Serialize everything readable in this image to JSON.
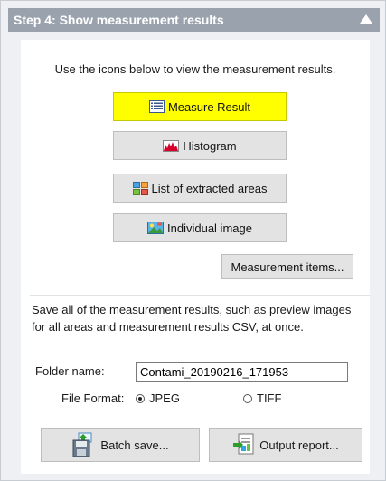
{
  "header": {
    "title": "Step 4: Show measurement results",
    "collapse_icon": "chevron-up-icon"
  },
  "intro": "Use the icons below to view the measurement results.",
  "buttons": {
    "measure_result": {
      "label": "Measure Result",
      "icon": "table-list-icon",
      "highlight": "#ffff00"
    },
    "histogram": {
      "label": "Histogram",
      "icon": "histogram-icon"
    },
    "list_extracted": {
      "label": "List of extracted areas",
      "icon": "area-list-icon"
    },
    "individual_image": {
      "label": "Individual image",
      "icon": "image-icon"
    },
    "measurement_items": {
      "label": "Measurement items..."
    }
  },
  "save_section": {
    "description": "Save all of the measurement results, such as preview images for all areas and measurement results CSV, at once.",
    "folder_label": "Folder name:",
    "folder_value": "Contami_20190216_171953",
    "format_label": "File Format:",
    "formats": [
      {
        "label": "JPEG",
        "selected": true
      },
      {
        "label": "TIFF",
        "selected": false
      }
    ],
    "batch_save": {
      "label": "Batch save...",
      "icon": "batch-save-icon"
    },
    "output_report": {
      "label": "Output report...",
      "icon": "output-report-icon"
    }
  }
}
